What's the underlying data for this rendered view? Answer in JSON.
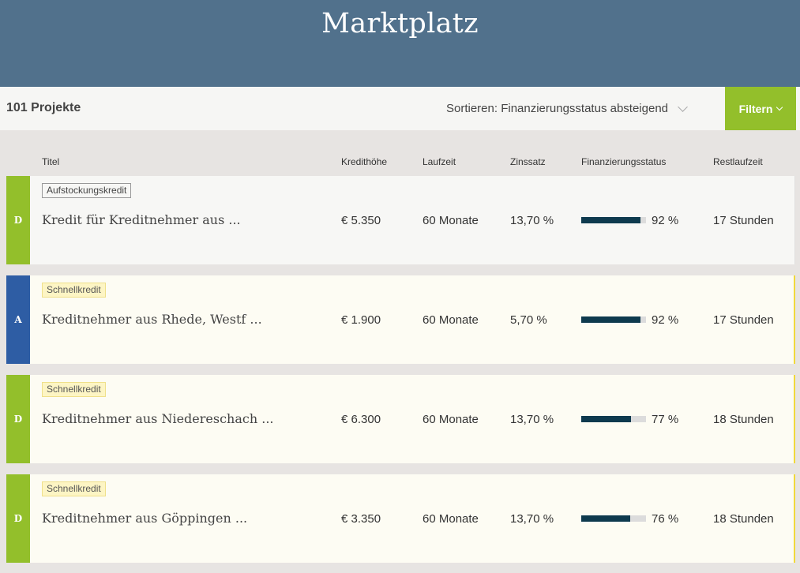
{
  "header": {
    "title": "Marktplatz"
  },
  "toolbar": {
    "count": "101 Projekte",
    "sort_label": "Sortieren: Finanzierungsstatus absteigend",
    "filter_label": "Filtern"
  },
  "columns": {
    "title": "Titel",
    "amount": "Kredithöhe",
    "term": "Laufzeit",
    "rate": "Zinssatz",
    "status": "Finanzierungsstatus",
    "remaining": "Restlaufzeit"
  },
  "colors": {
    "grade_d": "#93bf2b",
    "grade_a": "#2e5da4",
    "progress": "#0e3a4e",
    "accent": "#93bf2b",
    "header_bg": "#51718c"
  },
  "loans": [
    {
      "grade": "D",
      "tag": "Aufstockungskredit",
      "title": "Kredit für Kreditnehmer aus ...",
      "amount": "€ 5.350",
      "term": "60 Monate",
      "rate": "13,70 %",
      "progress": 92,
      "progress_label": "92 %",
      "remaining": "17 Stunden"
    },
    {
      "grade": "A",
      "tag": "Schnellkredit",
      "title": "Kreditnehmer aus Rhede, Westf ...",
      "amount": "€ 1.900",
      "term": "60 Monate",
      "rate": "5,70 %",
      "progress": 92,
      "progress_label": "92 %",
      "remaining": "17 Stunden"
    },
    {
      "grade": "D",
      "tag": "Schnellkredit",
      "title": "Kreditnehmer aus Niedereschach ...",
      "amount": "€ 6.300",
      "term": "60 Monate",
      "rate": "13,70 %",
      "progress": 77,
      "progress_label": "77 %",
      "remaining": "18 Stunden"
    },
    {
      "grade": "D",
      "tag": "Schnellkredit",
      "title": "Kreditnehmer aus Göppingen ...",
      "amount": "€ 3.350",
      "term": "60 Monate",
      "rate": "13,70 %",
      "progress": 76,
      "progress_label": "76 %",
      "remaining": "18 Stunden"
    }
  ]
}
